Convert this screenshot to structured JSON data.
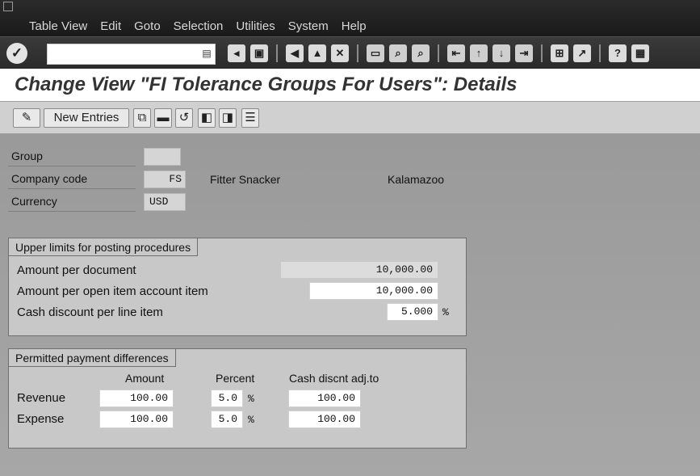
{
  "menu": {
    "items": [
      "Table View",
      "Edit",
      "Goto",
      "Selection",
      "Utilities",
      "System",
      "Help"
    ]
  },
  "toolbar": {
    "command_field_value": "",
    "icons": [
      "back",
      "exit",
      "cancel",
      "print",
      "find",
      "find-next",
      "first-page",
      "previous-page",
      "next-page",
      "last-page",
      "create-session",
      "shortcut",
      "help",
      "layout"
    ]
  },
  "title": "Change View \"FI Tolerance Groups For Users\": Details",
  "app_toolbar": {
    "new_entries_label": "New Entries"
  },
  "header_fields": {
    "group": {
      "label": "Group",
      "value": ""
    },
    "company_code": {
      "label": "Company code",
      "value": "FS",
      "name": "Fitter Snacker",
      "city": "Kalamazoo"
    },
    "currency": {
      "label": "Currency",
      "value": "USD"
    }
  },
  "upper_limits": {
    "title": "Upper limits for posting procedures",
    "amount_per_document": {
      "label": "Amount per document",
      "value": "10,000.00"
    },
    "amount_per_open_item": {
      "label": "Amount per open item account item",
      "value": "10,000.00"
    },
    "cash_discount": {
      "label": "Cash discount per line item",
      "value": "5.000",
      "unit": "%"
    }
  },
  "payment_differences": {
    "title": "Permitted payment differences",
    "columns": {
      "amount": "Amount",
      "percent": "Percent",
      "cash": "Cash discnt adj.to"
    },
    "rows": [
      {
        "label": "Revenue",
        "amount": "100.00",
        "percent": "5.0",
        "unit": "%",
        "cash": "100.00"
      },
      {
        "label": "Expense",
        "amount": "100.00",
        "percent": "5.0",
        "unit": "%",
        "cash": "100.00"
      }
    ]
  }
}
